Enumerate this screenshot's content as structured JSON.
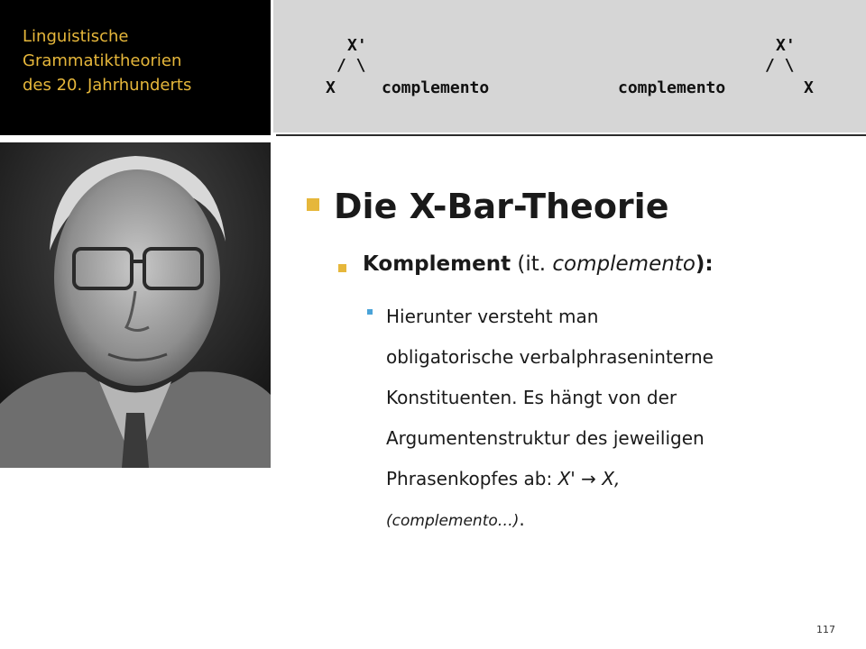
{
  "slide": {
    "title_lines": [
      "Linguistische",
      "Grammatiktheorien",
      "des 20. Jahrhunderts"
    ],
    "diagram": {
      "left_tree": {
        "root": "X'",
        "branches": "/ \\",
        "left_child": "X",
        "right_child": "complemento"
      },
      "right_tree": {
        "root": "X'",
        "branches": "/ \\",
        "left_child": "complemento",
        "right_child": "X"
      }
    },
    "heading": "Die X-Bar-Theorie",
    "sub": {
      "keyword": "Komplement",
      "paren_open": " (it. ",
      "italic": "complemento",
      "paren_close": "):"
    },
    "body": {
      "line1": "Hierunter versteht man",
      "line2": "obligatorische verbalphraseninterne",
      "line3": "Konstituenten. Es hängt von der",
      "line4": "Argumentenstruktur des jeweiligen",
      "line5_plain": "Phrasenkopfes ab: ",
      "line5_italic": "X' → X,",
      "line6_italic": "(complemento…)",
      "line6_plain": "."
    },
    "page_number": "117",
    "colors": {
      "accent": "#e6b73b",
      "bullet_l3": "#4aa3d8",
      "title_bg": "#000000",
      "diagram_bg": "#d6d6d6"
    }
  }
}
